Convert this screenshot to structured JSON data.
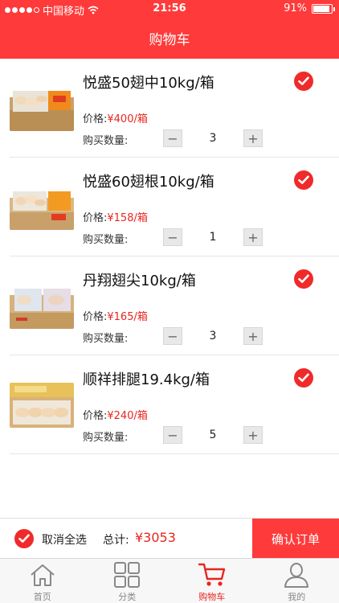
{
  "status": {
    "carrier": "中国移动",
    "time": "21:56",
    "battery": "91%",
    "battery_level": 0.91
  },
  "nav": {
    "title": "购物车"
  },
  "cart": {
    "price_label": "价格:",
    "qty_label": "购买数量:",
    "minus": "−",
    "plus": "+",
    "items": [
      {
        "name": "悦盛50翅中10kg/箱",
        "price": "¥400/箱",
        "qty": "3",
        "selected": true
      },
      {
        "name": "悦盛60翅根10kg/箱",
        "price": "¥158/箱",
        "qty": "1",
        "selected": true
      },
      {
        "name": "丹翔翅尖10kg/箱",
        "price": "¥165/箱",
        "qty": "3",
        "selected": true
      },
      {
        "name": "顺祥排腿19.4kg/箱",
        "price": "¥240/箱",
        "qty": "5",
        "selected": true
      }
    ]
  },
  "footer": {
    "deselect_all": "取消全选",
    "total_label": "总计:",
    "total_value": "¥3053",
    "confirm": "确认订单"
  },
  "tabs": [
    {
      "label": "首页",
      "icon": "home-icon",
      "active": false
    },
    {
      "label": "分类",
      "icon": "grid-icon",
      "active": false
    },
    {
      "label": "购物车",
      "icon": "cart-icon",
      "active": true
    },
    {
      "label": "我的",
      "icon": "person-icon",
      "active": false
    }
  ],
  "colors": {
    "brand": "#ff3a3a",
    "price": "#e8251f"
  }
}
